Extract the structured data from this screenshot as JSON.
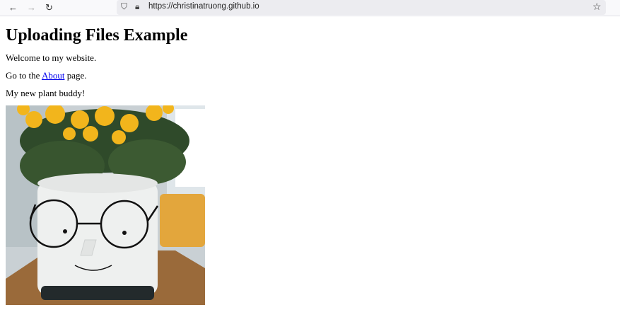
{
  "browser": {
    "url": "https://christinatruong.github.io",
    "icons": [
      "back-arrow-icon",
      "forward-arrow-icon",
      "reload-icon",
      "shield-icon",
      "lock-icon",
      "star-icon"
    ]
  },
  "page": {
    "title": "Uploading Files Example",
    "welcome": "Welcome to my website.",
    "goto_prefix": "Go to the",
    "about_link": "About",
    "goto_suffix": "page.",
    "plant_caption": "My new plant buddy!"
  }
}
